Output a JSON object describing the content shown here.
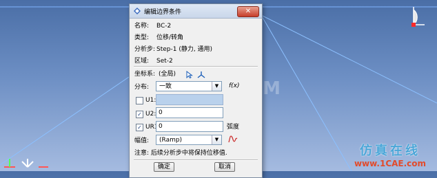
{
  "dialog": {
    "title": "编辑边界条件",
    "close_label": "✕",
    "name_label": "名称:",
    "name_value": "BC-2",
    "type_label": "类型:",
    "type_value": "位移/转角",
    "step_label": "分析步:",
    "step_value": "Step-1 (静力, 通用)",
    "region_label": "区域:",
    "region_value": "Set-2",
    "csys_label": "坐标系:",
    "csys_value": "(全局)",
    "distribution_label": "分布:",
    "distribution_value": "一致",
    "fx_label": "f(x)",
    "u1_label": "U1:",
    "u1_checked": false,
    "u1_value": "",
    "u2_label": "U2:",
    "u2_checked": true,
    "u2_value": "0",
    "ur3_label": "UR3:",
    "ur3_checked": true,
    "ur3_value": "0",
    "ur3_unit": "弧度",
    "amplitude_label": "幅值:",
    "amplitude_value": "(Ramp)",
    "note": "注意: 后续分析步中将保持位移值.",
    "ok_label": "确定",
    "cancel_label": "取消"
  },
  "watermark": {
    "center": "1CAE.COM",
    "brand_cn": "仿真在线",
    "brand_url": "www.1CAE.com"
  },
  "colors": {
    "viewport_top": "#4a6ea6",
    "viewport_bottom": "#a5bbe0",
    "brand_blue": "#4aa6d8",
    "brand_red": "#e24b2b"
  }
}
